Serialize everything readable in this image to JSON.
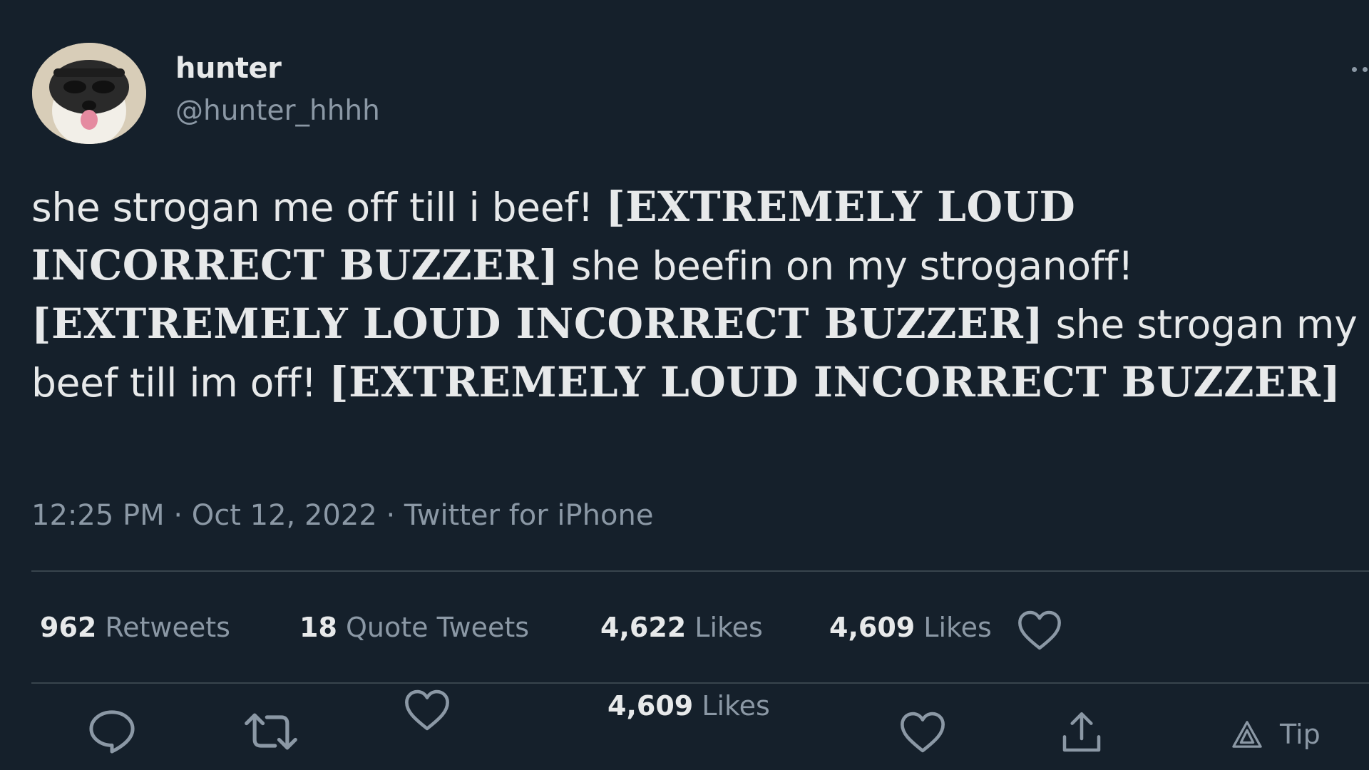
{
  "author": {
    "display_name": "hunter",
    "handle": "@hunter_hhhh",
    "avatar_icon": "dog-avatar"
  },
  "tweet": {
    "segments": [
      {
        "text": "she strogan me off till i beef! ",
        "loud": false
      },
      {
        "text": "[EXTREMELY LOUD INCORRECT BUZZER]",
        "loud": true
      },
      {
        "text": " she beefin on my stroganoff! ",
        "loud": false
      },
      {
        "text": "[EXTREMELY LOUD INCORRECT BUZZER]",
        "loud": true
      },
      {
        "text": " she strogan my beef till im off! ",
        "loud": false
      },
      {
        "text": "[EXTREMELY LOUD INCORRECT BUZZER]",
        "loud": true
      }
    ],
    "meta": "12:25 PM · Oct 12, 2022 · Twitter for iPhone"
  },
  "stats": {
    "retweets_count": "962",
    "retweets_label": "Retweets",
    "quotes_count": "18",
    "quotes_label": "Quote Tweets",
    "likes_count": "4,622",
    "likes_label": "Likes",
    "likes2_count": "4,609",
    "likes2_label": "Likes",
    "likes3_count": "4,609",
    "likes3_label": "Likes"
  },
  "actions": {
    "tip_label": "Tip"
  },
  "colors": {
    "background": "#15202b",
    "text_primary": "#e7e9ea",
    "text_secondary": "#8b98a5",
    "divider": "#38444d"
  }
}
